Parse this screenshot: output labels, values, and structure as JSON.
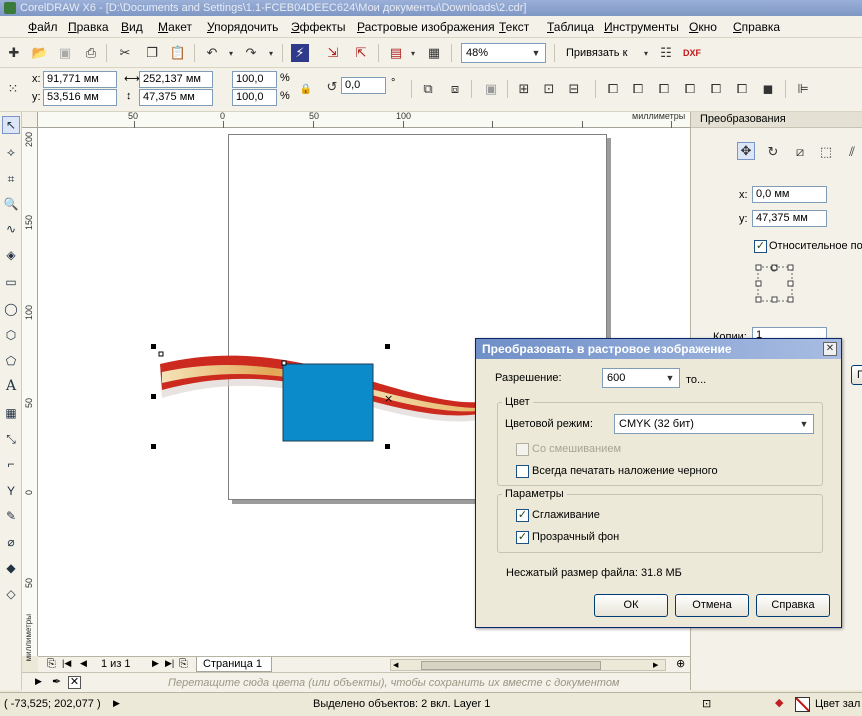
{
  "window": {
    "title": "CorelDRAW X6 - [D:\\Documents and Settings\\1.1-FCEB04DEEC624\\Мои документы\\Downloads\\2.cdr]"
  },
  "menu": [
    "Файл",
    "Правка",
    "Вид",
    "Макет",
    "Упорядочить",
    "Эффекты",
    "Растровые изображения",
    "Текст",
    "Таблица",
    "Инструменты",
    "Окно",
    "Справка"
  ],
  "standard_toolbar": {
    "zoom": "48%",
    "snap_label": "Привязать к"
  },
  "property_bar": {
    "x_label": "x:",
    "x_value": "91,771 мм",
    "y_label": "y:",
    "y_value": "53,516 мм",
    "width_value": "252,137 мм",
    "height_value": "47,375 мм",
    "scale_x": "100,0",
    "scale_y": "100,0",
    "percent": "%",
    "rotation": "0,0",
    "degree": "°"
  },
  "ruler": {
    "unit": "миллиметры",
    "top_ticks": [
      "50",
      "0",
      "50",
      "100"
    ],
    "left_ticks": [
      "200",
      "150",
      "100",
      "50",
      "0",
      "50"
    ]
  },
  "dock": {
    "title": "Преобразования",
    "x_label": "x:",
    "x_value": "0,0 мм",
    "y_label": "y:",
    "y_value": "47,375 мм",
    "relative_label": "Относительное по",
    "copies_label": "Копии:",
    "copies_value": "1",
    "apply_label": "П"
  },
  "dialog": {
    "title": "Преобразовать в растровое изображение",
    "resolution_label": "Разрешение:",
    "resolution_value": "600",
    "resolution_unit": "то...",
    "color_group": "Цвет",
    "color_mode_label": "Цветовой режим:",
    "color_mode_value": "CMYK (32 бит)",
    "dithered_label": "Со смешиванием",
    "overprint_label": "Всегда печатать наложение черного",
    "options_group": "Параметры",
    "antialias_label": "Сглаживание",
    "transparent_label": "Прозрачный фон",
    "filesize_label": "Несжатый размер файла: 31.8 МБ",
    "ok_label": "ОК",
    "cancel_label": "Отмена",
    "help_label": "Справка"
  },
  "pagebar": {
    "page_count": "1 из 1",
    "page_tab": "Страница 1"
  },
  "palettebar": {
    "hint": "Перетащите сюда цвета (или объекты), чтобы сохранить их вместе с документом"
  },
  "status": {
    "coords": "( -73,525; 202,077 )",
    "selection": "Выделено объектов: 2 вкл. Layer 1",
    "fill_label": "Цвет зал"
  },
  "colors": {
    "blue_square": "#0b8bc9",
    "ribbon_red": "#cc2a1e",
    "ribbon_gold": "#e8c07a"
  }
}
